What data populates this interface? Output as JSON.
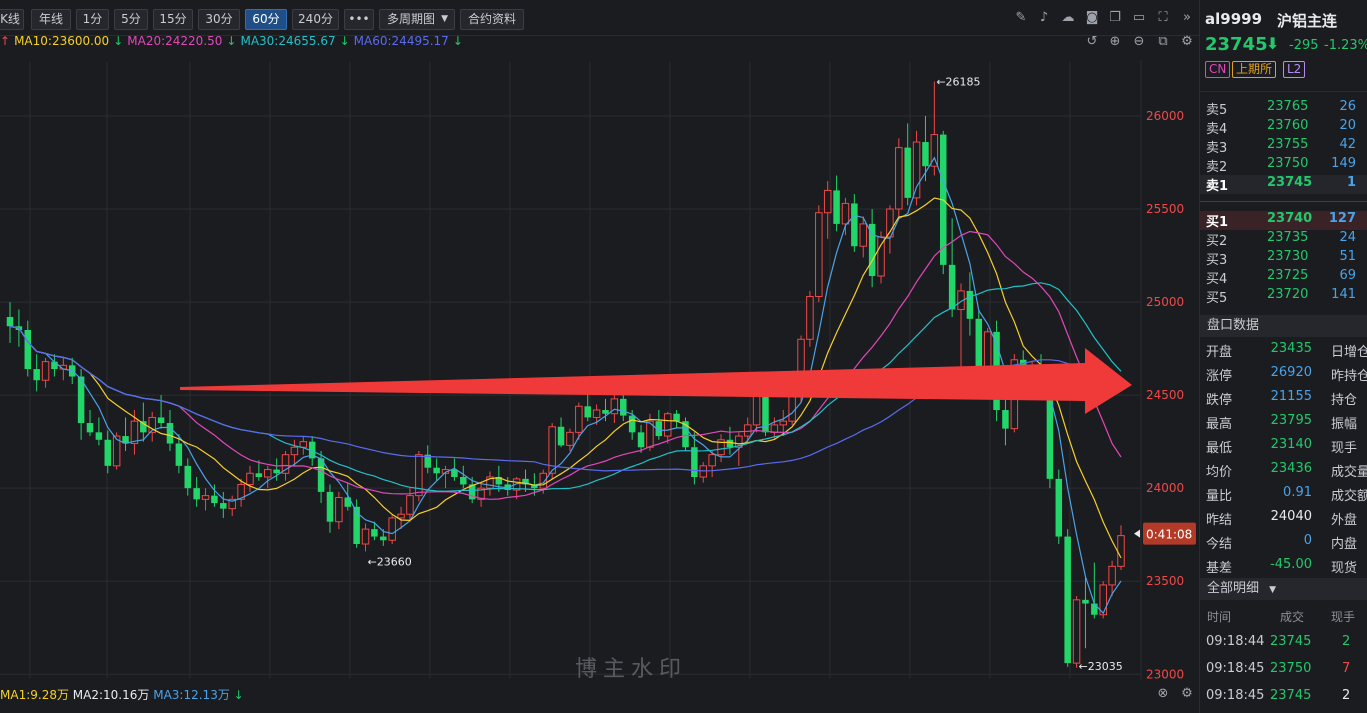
{
  "toolbar": {
    "buttons": [
      "K线",
      "年线",
      "1分",
      "5分",
      "15分",
      "30分",
      "60分",
      "240分",
      "•••",
      "多周期图",
      "合约资料"
    ],
    "active": "60分"
  },
  "ma_legend": [
    {
      "label": "MA10:23600.00",
      "color": "#f5d028",
      "arrow": "↓"
    },
    {
      "label": "MA20:24220.50",
      "color": "#e048b8",
      "arrow": "↓"
    },
    {
      "label": "MA30:24655.67",
      "color": "#22c0c8",
      "arrow": "↓"
    },
    {
      "label": "MA60:24495.17",
      "color": "#5a6bf0",
      "arrow": "↓"
    }
  ],
  "vol_legend": [
    {
      "label": "MA1:9.28万",
      "color": "#f5d028"
    },
    {
      "label": "MA2:10.16万",
      "color": "#e8eaee"
    },
    {
      "label": "MA3:12.13万",
      "color": "#4aa3e8"
    }
  ],
  "chart_data": {
    "type": "candlestick",
    "y_ticks": [
      23000,
      23500,
      24000,
      24500,
      25000,
      25500,
      26000
    ],
    "ylim": [
      22980,
      26290
    ],
    "annotations": [
      {
        "label": "←26185",
        "value": 26185
      },
      {
        "label": "←23660",
        "value": 23660
      },
      {
        "label": "←23035",
        "value": 23035
      }
    ],
    "countdown": "0:41:08",
    "last_price": 23745,
    "candles": [
      [
        24920,
        25000,
        24780,
        24870
      ],
      [
        24870,
        24960,
        24760,
        24850
      ],
      [
        24850,
        24900,
        24600,
        24640
      ],
      [
        24640,
        24720,
        24520,
        24580
      ],
      [
        24580,
        24700,
        24540,
        24680
      ],
      [
        24680,
        24720,
        24600,
        24640
      ],
      [
        24640,
        24700,
        24580,
        24660
      ],
      [
        24660,
        24700,
        24560,
        24600
      ],
      [
        24600,
        24640,
        24260,
        24350
      ],
      [
        24350,
        24420,
        24280,
        24300
      ],
      [
        24300,
        24380,
        24230,
        24260
      ],
      [
        24260,
        24310,
        24080,
        24120
      ],
      [
        24120,
        24300,
        24100,
        24280
      ],
      [
        24280,
        24380,
        24200,
        24240
      ],
      [
        24240,
        24420,
        24180,
        24360
      ],
      [
        24360,
        24460,
        24250,
        24300
      ],
      [
        24300,
        24410,
        24250,
        24380
      ],
      [
        24380,
        24500,
        24320,
        24350
      ],
      [
        24350,
        24420,
        24200,
        24240
      ],
      [
        24240,
        24290,
        24080,
        24120
      ],
      [
        24120,
        24160,
        23960,
        24000
      ],
      [
        24000,
        24060,
        23900,
        23940
      ],
      [
        23940,
        24000,
        23880,
        23960
      ],
      [
        23960,
        24020,
        23900,
        23920
      ],
      [
        23920,
        23980,
        23840,
        23890
      ],
      [
        23890,
        23960,
        23850,
        23940
      ],
      [
        23940,
        24050,
        23900,
        24020
      ],
      [
        24020,
        24120,
        23980,
        24080
      ],
      [
        24080,
        24150,
        24040,
        24060
      ],
      [
        24060,
        24120,
        24000,
        24100
      ],
      [
        24100,
        24160,
        24040,
        24080
      ],
      [
        24080,
        24200,
        24040,
        24180
      ],
      [
        24180,
        24260,
        24120,
        24220
      ],
      [
        24220,
        24280,
        24180,
        24250
      ],
      [
        24250,
        24280,
        24120,
        24160
      ],
      [
        24160,
        24200,
        23920,
        23980
      ],
      [
        23980,
        24020,
        23760,
        23820
      ],
      [
        23820,
        23980,
        23780,
        23950
      ],
      [
        23950,
        24030,
        23880,
        23900
      ],
      [
        23900,
        23940,
        23680,
        23700
      ],
      [
        23700,
        23810,
        23660,
        23780
      ],
      [
        23780,
        23820,
        23720,
        23740
      ],
      [
        23740,
        23780,
        23690,
        23720
      ],
      [
        23720,
        23860,
        23700,
        23840
      ],
      [
        23840,
        23900,
        23780,
        23860
      ],
      [
        23860,
        24000,
        23820,
        23960
      ],
      [
        23960,
        24200,
        23930,
        24180
      ],
      [
        24180,
        24230,
        24080,
        24110
      ],
      [
        24110,
        24160,
        24040,
        24080
      ],
      [
        24080,
        24120,
        24000,
        24100
      ],
      [
        24100,
        24160,
        24040,
        24060
      ],
      [
        24060,
        24120,
        24000,
        24020
      ],
      [
        24020,
        24060,
        23920,
        23940
      ],
      [
        23940,
        24030,
        23900,
        24000
      ],
      [
        24000,
        24090,
        23960,
        24060
      ],
      [
        24060,
        24120,
        23980,
        24020
      ],
      [
        24020,
        24060,
        23960,
        23990
      ],
      [
        23990,
        24060,
        23940,
        24050
      ],
      [
        24050,
        24100,
        23980,
        24020
      ],
      [
        24020,
        24080,
        23960,
        24000
      ],
      [
        24000,
        24100,
        23970,
        24080
      ],
      [
        24080,
        24350,
        24050,
        24330
      ],
      [
        24330,
        24380,
        24220,
        24230
      ],
      [
        24230,
        24320,
        24200,
        24300
      ],
      [
        24300,
        24460,
        24260,
        24440
      ],
      [
        24440,
        24520,
        24360,
        24380
      ],
      [
        24380,
        24450,
        24340,
        24420
      ],
      [
        24420,
        24480,
        24360,
        24400
      ],
      [
        24400,
        24520,
        24350,
        24480
      ],
      [
        24480,
        24570,
        24360,
        24390
      ],
      [
        24390,
        24420,
        24260,
        24300
      ],
      [
        24300,
        24340,
        24190,
        24220
      ],
      [
        24220,
        24400,
        24200,
        24360
      ],
      [
        24360,
        24420,
        24260,
        24280
      ],
      [
        24280,
        24410,
        24240,
        24400
      ],
      [
        24400,
        24420,
        24320,
        24360
      ],
      [
        24360,
        24380,
        24200,
        24220
      ],
      [
        24220,
        24300,
        24020,
        24060
      ],
      [
        24060,
        24140,
        24030,
        24120
      ],
      [
        24120,
        24200,
        24060,
        24180
      ],
      [
        24180,
        24290,
        24140,
        24260
      ],
      [
        24260,
        24330,
        24180,
        24220
      ],
      [
        24220,
        24300,
        24120,
        24280
      ],
      [
        24280,
        24380,
        24240,
        24340
      ],
      [
        24340,
        24550,
        24300,
        24520
      ],
      [
        24520,
        24560,
        24280,
        24300
      ],
      [
        24300,
        24380,
        24260,
        24340
      ],
      [
        24340,
        24420,
        24280,
        24360
      ],
      [
        24360,
        24520,
        24340,
        24500
      ],
      [
        24500,
        24820,
        24460,
        24800
      ],
      [
        24800,
        25060,
        24760,
        25030
      ],
      [
        25030,
        25520,
        25000,
        25480
      ],
      [
        25480,
        25650,
        25340,
        25600
      ],
      [
        25600,
        25680,
        25380,
        25420
      ],
      [
        25420,
        25560,
        25360,
        25530
      ],
      [
        25530,
        25580,
        25270,
        25300
      ],
      [
        25300,
        25460,
        25240,
        25420
      ],
      [
        25420,
        25500,
        25080,
        25140
      ],
      [
        25140,
        25380,
        25100,
        25350
      ],
      [
        25350,
        25520,
        25260,
        25500
      ],
      [
        25500,
        25880,
        25450,
        25830
      ],
      [
        25830,
        25960,
        25520,
        25560
      ],
      [
        25560,
        25920,
        25520,
        25860
      ],
      [
        25860,
        26000,
        25650,
        25730
      ],
      [
        25730,
        26185,
        25680,
        25900
      ],
      [
        25900,
        25920,
        25150,
        25200
      ],
      [
        25200,
        25450,
        24920,
        24960
      ],
      [
        24960,
        25100,
        24640,
        25060
      ],
      [
        25060,
        25160,
        24820,
        24910
      ],
      [
        24910,
        24960,
        24630,
        24640
      ],
      [
        24640,
        24860,
        24560,
        24840
      ],
      [
        24840,
        24900,
        24360,
        24420
      ],
      [
        24420,
        24480,
        24230,
        24320
      ],
      [
        24320,
        24720,
        24300,
        24690
      ],
      [
        24690,
        24740,
        24520,
        24600
      ],
      [
        24600,
        24680,
        24560,
        24650
      ],
      [
        24650,
        24720,
        24480,
        24500
      ],
      [
        24500,
        24520,
        24000,
        24050
      ],
      [
        24050,
        24100,
        23700,
        23740
      ],
      [
        23740,
        23780,
        23040,
        23060
      ],
      [
        23060,
        23420,
        23035,
        23400
      ],
      [
        23400,
        23520,
        23140,
        23380
      ],
      [
        23380,
        23600,
        23300,
        23320
      ],
      [
        23320,
        23500,
        23300,
        23480
      ],
      [
        23480,
        23610,
        23420,
        23580
      ],
      [
        23580,
        23800,
        23560,
        23745
      ]
    ]
  },
  "watermark": "博主水印",
  "quote": {
    "symbol": "al9999",
    "name": "沪铝主连",
    "price": "23745",
    "change": "-295",
    "change_pct": "-1.23%",
    "tags": [
      "CN",
      "上期所",
      "L2"
    ]
  },
  "asks": [
    {
      "label": "卖5",
      "price": "23765",
      "vol": "26"
    },
    {
      "label": "卖4",
      "price": "23760",
      "vol": "20"
    },
    {
      "label": "卖3",
      "price": "23755",
      "vol": "42"
    },
    {
      "label": "卖2",
      "price": "23750",
      "vol": "149"
    },
    {
      "label": "卖1",
      "price": "23745",
      "vol": "1"
    }
  ],
  "bids": [
    {
      "label": "买1",
      "price": "23740",
      "vol": "127"
    },
    {
      "label": "买2",
      "price": "23735",
      "vol": "24"
    },
    {
      "label": "买3",
      "price": "23730",
      "vol": "51"
    },
    {
      "label": "买4",
      "price": "23725",
      "vol": "69"
    },
    {
      "label": "买5",
      "price": "23720",
      "vol": "141"
    }
  ],
  "pankou": {
    "title": "盘口数据",
    "rows": [
      {
        "label": "开盘",
        "value": "23435",
        "color": "green",
        "right": "日增仓"
      },
      {
        "label": "涨停",
        "value": "26920",
        "color": "blue",
        "right": "昨持仓"
      },
      {
        "label": "跌停",
        "value": "21155",
        "color": "blue",
        "right": "持仓"
      },
      {
        "label": "最高",
        "value": "23795",
        "color": "green",
        "right": "振幅"
      },
      {
        "label": "最低",
        "value": "23140",
        "color": "green",
        "right": "现手"
      },
      {
        "label": "均价",
        "value": "23436",
        "color": "green",
        "right": "成交量"
      },
      {
        "label": "量比",
        "value": "0.91",
        "color": "blue",
        "right": "成交额"
      },
      {
        "label": "昨结",
        "value": "24040",
        "color": "white",
        "right": "外盘"
      },
      {
        "label": "今结",
        "value": "0",
        "color": "blue",
        "right": "内盘"
      },
      {
        "label": "基差",
        "value": "-45.00",
        "color": "green",
        "right": "现货"
      }
    ]
  },
  "details": {
    "title": "全部明细",
    "headers": [
      "时间",
      "成交",
      "现手"
    ],
    "rows": [
      {
        "time": "09:18:44",
        "price": "23745",
        "vol": "2",
        "vcolor": "green"
      },
      {
        "time": "09:18:45",
        "price": "23750",
        "vol": "7",
        "vcolor": "red"
      },
      {
        "time": "09:18:45",
        "price": "23745",
        "vol": "2",
        "vcolor": "white"
      }
    ]
  }
}
